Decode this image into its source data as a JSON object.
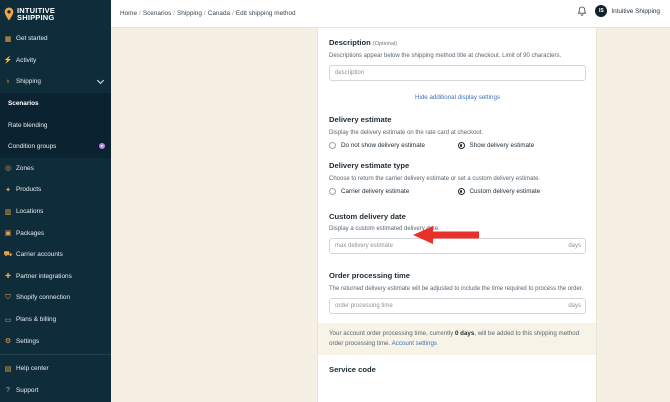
{
  "app": {
    "logo_line1": "INTUITIVE",
    "logo_line2": "SHIPPING"
  },
  "sidebar": {
    "items": [
      {
        "label": "Get started",
        "icon": "dashboard-icon"
      },
      {
        "label": "Activity",
        "icon": "activity-icon"
      },
      {
        "label": "Shipping",
        "icon": "lightbulb-icon"
      },
      {
        "label": "Scenarios"
      },
      {
        "label": "Rate blending"
      },
      {
        "label": "Condition groups"
      },
      {
        "label": "Zones",
        "icon": "globe-icon"
      },
      {
        "label": "Products",
        "icon": "gift-icon"
      },
      {
        "label": "Locations",
        "icon": "building-icon"
      },
      {
        "label": "Packages",
        "icon": "package-icon"
      },
      {
        "label": "Carrier accounts",
        "icon": "truck-icon"
      },
      {
        "label": "Partner integrations",
        "icon": "puzzle-icon"
      },
      {
        "label": "Shopify connection",
        "icon": "shopify-icon"
      },
      {
        "label": "Plans & billing",
        "icon": "card-icon"
      },
      {
        "label": "Settings",
        "icon": "gear-icon"
      }
    ],
    "bottom": [
      {
        "label": "Help center",
        "icon": "book-icon"
      },
      {
        "label": "Support",
        "icon": "question-icon"
      }
    ],
    "accent": "#f0a646"
  },
  "topbar": {
    "breadcrumb": [
      "Home",
      "Scenarios",
      "Shipping",
      "Canada",
      "Edit shipping method"
    ],
    "avatar_initials": "IS",
    "user_name": "Intuitive Shipping"
  },
  "form": {
    "description": {
      "title": "Description",
      "optional": "(Optional)",
      "help": "Descriptions appear below the shipping method title at checkout. Limit of 90 characters.",
      "placeholder": "description"
    },
    "hide_link": "Hide additional display settings",
    "delivery_estimate": {
      "title": "Delivery estimate",
      "help": "Display the delivery estimate on the rate card at checkout.",
      "option_a": "Do not show delivery estimate",
      "option_b": "Show delivery estimate",
      "selected": "Show delivery estimate"
    },
    "delivery_estimate_type": {
      "title": "Delivery estimate type",
      "help": "Choose to return the carrier delivery estimate or set a custom delivery estimate.",
      "option_a": "Carrier delivery estimate",
      "option_b": "Custom delivery estimate",
      "selected": "Custom delivery estimate"
    },
    "custom_delivery_date": {
      "title": "Custom delivery date",
      "help": "Display a custom estimated delivery date.",
      "placeholder": "max delivery estimate",
      "suffix": "days"
    },
    "order_processing_time": {
      "title": "Order processing time",
      "help": "The returned delivery estimate will be adjusted to include the time required to process the order.",
      "placeholder": "order processing time",
      "suffix": "days"
    },
    "note": {
      "text_before": "Your account order processing time, currently ",
      "days": "0 days",
      "text_after": ", will be added to this shipping method order processing time. ",
      "link": "Account settings"
    },
    "next_section_title": "Service code"
  },
  "annotation_color": "#e8312a"
}
